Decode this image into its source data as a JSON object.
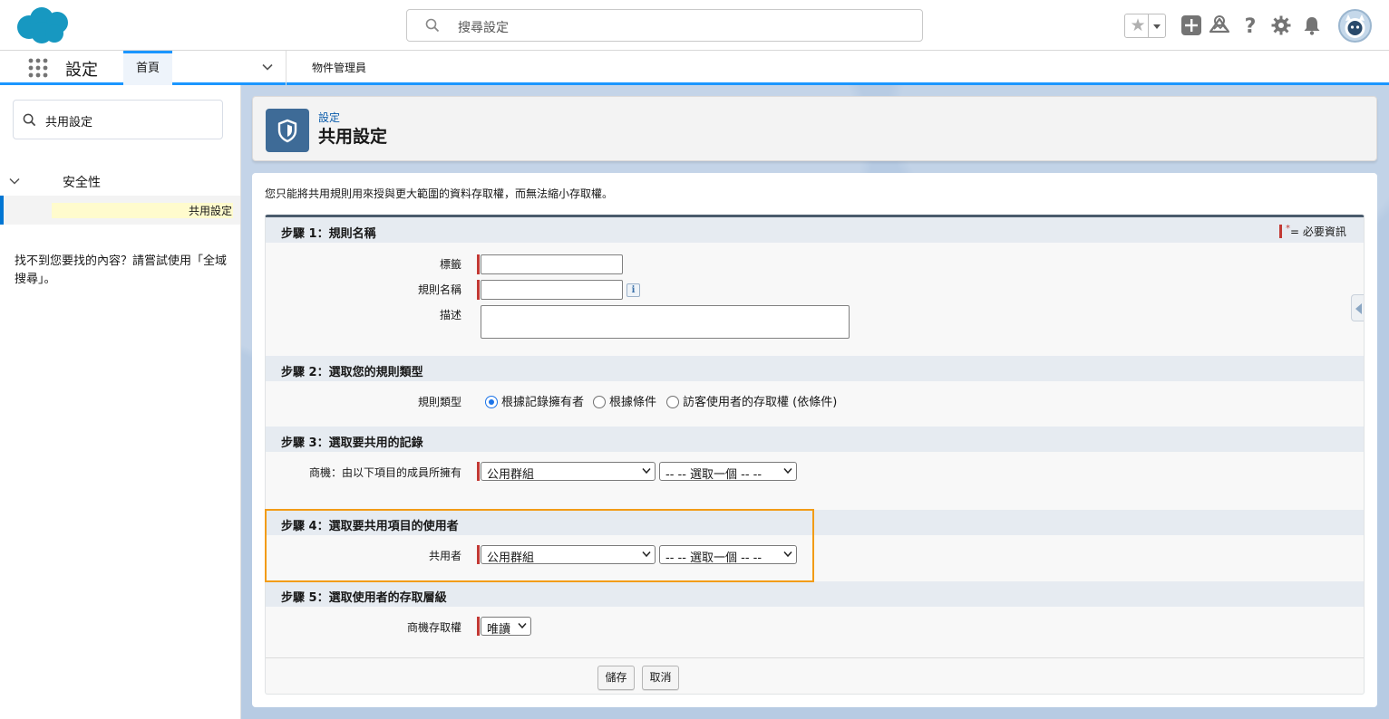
{
  "header": {
    "search_placeholder": "搜尋設定",
    "icons": [
      "salesforce-cloud-logo",
      "search-icon",
      "favorite-star-icon",
      "add-icon",
      "trailhead-icon",
      "help-icon",
      "gear-icon",
      "bell-icon",
      "avatar"
    ]
  },
  "nav": {
    "app_title": "設定",
    "tab_home": "首頁",
    "tab_object_manager": "物件管理員"
  },
  "sidebar": {
    "quick_find": "共用設定",
    "tree_parent": "安全性",
    "tree_child": "共用設定",
    "help_text": "找不到您要找的內容？請嘗試使用「全域搜尋」。"
  },
  "page_header": {
    "breadcrumb": "設定",
    "title": "共用設定"
  },
  "intro": "您只能將共用規則用來授與更大範圍的資料存取權，而無法縮小存取權。",
  "form": {
    "required_legend": "= 必要資訊",
    "step1": {
      "title": "步驟 1：規則名稱",
      "label_field": "標籤",
      "rule_name_field": "規則名稱",
      "description_field": "描述"
    },
    "step2": {
      "title": "步驟 2：選取您的規則類型",
      "rule_type_label": "規則類型",
      "options": [
        "根據記錄擁有者",
        "根據條件",
        "訪客使用者的存取權 (依條件)"
      ],
      "selected": "根據記錄擁有者"
    },
    "step3": {
      "title": "步驟 3：選取要共用的記錄",
      "label": "商機：由以下項目的成員所擁有",
      "select1": "公用群組",
      "select2": "-- -- 選取一個 -- --"
    },
    "step4": {
      "title": "步驟 4：選取要共用項目的使用者",
      "label": "共用者",
      "select1": "公用群組",
      "select2": "-- -- 選取一個 -- --"
    },
    "step5": {
      "title": "步驟 5：選取使用者的存取層級",
      "label": "商機存取權",
      "select": "唯讀"
    },
    "save_button": "儲存",
    "cancel_button": "取消"
  },
  "colors": {
    "brand_blue": "#1b96ff",
    "highlight_orange": "#f29c16",
    "required_red": "#c23934",
    "page_icon": "#3e6b97"
  }
}
